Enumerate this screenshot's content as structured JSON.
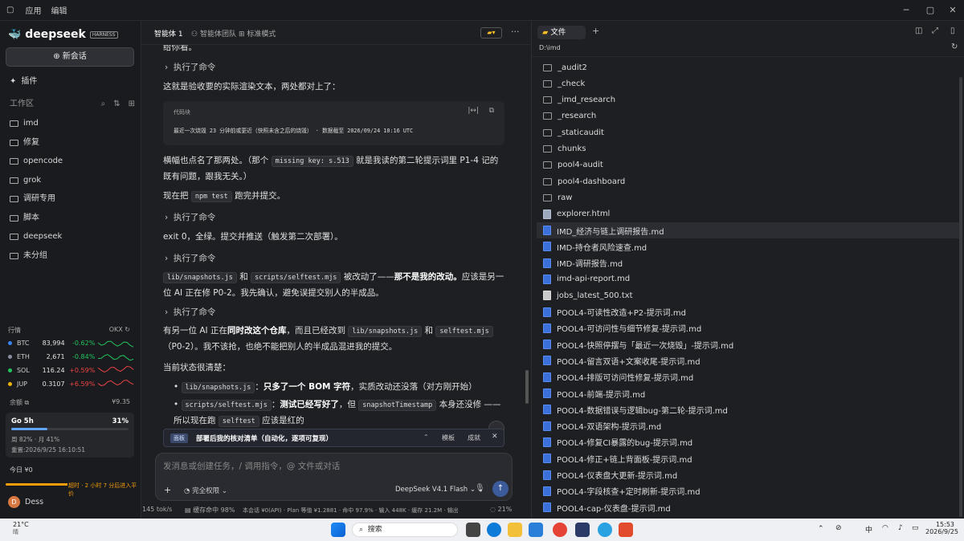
{
  "menubar": {
    "items": [
      "应用",
      "编辑"
    ]
  },
  "sidebar": {
    "brand": "deepseek",
    "brand_badge": "HARNESS",
    "new_chat": "新会话",
    "plugins": "插件",
    "workspace_label": "工作区",
    "folders": [
      "imd",
      "修复",
      "opencode",
      "grok",
      "调研专用",
      "脚本",
      "deepseek",
      "未分组"
    ],
    "market": {
      "title": "行情",
      "source": "OKX",
      "tickers": [
        {
          "sym": "BTC",
          "price": "83,994",
          "change": "-0.62%",
          "color": "#3b82f6"
        },
        {
          "sym": "ETH",
          "price": "2,671",
          "change": "-0.84%",
          "color": "#8b8fa3"
        },
        {
          "sym": "SOL",
          "price": "116.24",
          "change": "+0.59%",
          "color": "#22c55e"
        },
        {
          "sym": "JUP",
          "price": "0.3107",
          "change": "+6.59%",
          "color": "#eab308"
        }
      ]
    },
    "balance_label": "余额",
    "balance_value": "¥9.35",
    "plan": {
      "name": "Go 5h",
      "percent": "31%",
      "usage": "周 82% · 月 41%",
      "reset": "重置:2026/9/25 16:10:51",
      "fill": 0.31
    },
    "today": "今日 ¥0",
    "warning": "超时 · 2 小时 7 分后进入平价",
    "user": "Dess",
    "avatar_letter": "D"
  },
  "main": {
    "tabs": [
      "智能体 1",
      "智能体团队",
      "标准模式"
    ],
    "top_text": "给你看。",
    "exec_label": "执行了命令",
    "p1": "这就是验收要的实际渲染文本，两处都对上了：",
    "code_block": {
      "label": "代码块",
      "content": "最近一次烧毁 23 分钟前或更近（快照未含之后的烧毁） · 数据截至 2026/09/24 10:16 UTC"
    },
    "p2a": "横幅也点名了那两处。（那个",
    "p2code": "missing key: s.513",
    "p2b": "就是我读的第二轮提示词里 P1-4 记的既有问题，跟我无关。）",
    "p3a": "现在把",
    "p3code": "npm test",
    "p3b": "跑完并提交。",
    "p4": "exit 0，全绿。提交并推送（触发第二次部署）。",
    "p5code1": "lib/snapshots.js",
    "p5and": "和",
    "p5code2": "scripts/selftest.mjs",
    "p5mid": "被改动了——",
    "p5bold": "那不是我的改动。",
    "p5end": "应该是另一位 AI 正在修 P0-2。我先确认，避免误提交别人的半成品。",
    "p6a": "有另一位 AI 正在",
    "p6bold": "同时改这个仓库",
    "p6b": "，而且已经改到",
    "p6code1": "lib/snapshots.js",
    "p6and": "和",
    "p6code2": "selftest.mjs",
    "p6c": "（P0-2）。我不该抢，也绝不能把别人的半成品混进我的提交。",
    "p7": "当前状态很清楚：",
    "b1code": "lib/snapshots.js",
    "b1bold": "只多了一个 BOM 字符",
    "b1rest": "，实质改动还没落（对方刚开始）",
    "b2code": "scripts/selftest.mjs",
    "b2bold": "测试已经写好了",
    "b2mid": "，但",
    "b2code2": "snapshotTimestamp",
    "b2rest": "本身还没修 ——所以现在跑",
    "b2code3": "selftest",
    "b2end": "应该是红的",
    "checklist": {
      "tag": "面板",
      "title": "部署后我的核对清单（自动化，逐项可复现）",
      "btn1": "模板",
      "btn2": "成就"
    },
    "input_placeholder": "发消息或创建任务，/ 调用指令，@ 文件或对话",
    "permission": "完全权限",
    "model": "DeepSeek V4.1 Flash",
    "status": {
      "speed": "145 tok/s",
      "cache": "缓存命中 98%",
      "detail": "本会话 ¥0(API) · Plan 等值 ¥1.2881 · 命中 97.9% · 输入 448K · 缓存 21.2M · 输出 ...",
      "ctx": "21%"
    }
  },
  "files": {
    "tab": "文件",
    "path": "D:\\imd",
    "items": [
      {
        "name": "_audit2",
        "type": "folder"
      },
      {
        "name": "_check",
        "type": "folder"
      },
      {
        "name": "_imd_research",
        "type": "folder"
      },
      {
        "name": "_research",
        "type": "folder"
      },
      {
        "name": "_staticaudit",
        "type": "folder"
      },
      {
        "name": "chunks",
        "type": "folder"
      },
      {
        "name": "pool4-audit",
        "type": "folder"
      },
      {
        "name": "pool4-dashboard",
        "type": "folder"
      },
      {
        "name": "raw",
        "type": "folder"
      },
      {
        "name": "explorer.html",
        "type": "html"
      },
      {
        "name": "IMD_经济与链上调研报告.md",
        "type": "md"
      },
      {
        "name": "IMD-持仓者风险速查.md",
        "type": "md"
      },
      {
        "name": "IMD-调研报告.md",
        "type": "md"
      },
      {
        "name": "imd-api-report.md",
        "type": "md"
      },
      {
        "name": "jobs_latest_500.txt",
        "type": "txt"
      },
      {
        "name": "POOL4-可读性改造+P2-提示词.md",
        "type": "md"
      },
      {
        "name": "POOL4-可访问性与细节修复-提示词.md",
        "type": "md"
      },
      {
        "name": "POOL4-快照停摆与「最近一次烧毁」-提示词.md",
        "type": "md"
      },
      {
        "name": "POOL4-留言双语+文案收尾-提示词.md",
        "type": "md"
      },
      {
        "name": "POOL4-排版可访问性修复-提示词.md",
        "type": "md"
      },
      {
        "name": "POOL4-前端-提示词.md",
        "type": "md"
      },
      {
        "name": "POOL4-数据错误与逻辑bug-第二轮-提示词.md",
        "type": "md"
      },
      {
        "name": "POOL4-双语架构-提示词.md",
        "type": "md"
      },
      {
        "name": "POOL4-修复CI暴露的bug-提示词.md",
        "type": "md"
      },
      {
        "name": "POOL4-修正+链上背面板-提示词.md",
        "type": "md"
      },
      {
        "name": "POOL4-仪表盘大更新-提示词.md",
        "type": "md"
      },
      {
        "name": "POOL4-字段核查+定时刷新-提示词.md",
        "type": "md"
      },
      {
        "name": "POOL4-cap-仪表盘-提示词.md",
        "type": "md"
      }
    ]
  },
  "taskbar": {
    "weather": "21°C",
    "weather_sub": "晴",
    "search": "搜索",
    "lang": "中",
    "time": "15:53",
    "date": "2026/9/25"
  },
  "colors": {
    "accent": "#3b82f6",
    "up": "#ef4444",
    "down": "#22c55e",
    "warning": "#f59e0b"
  }
}
